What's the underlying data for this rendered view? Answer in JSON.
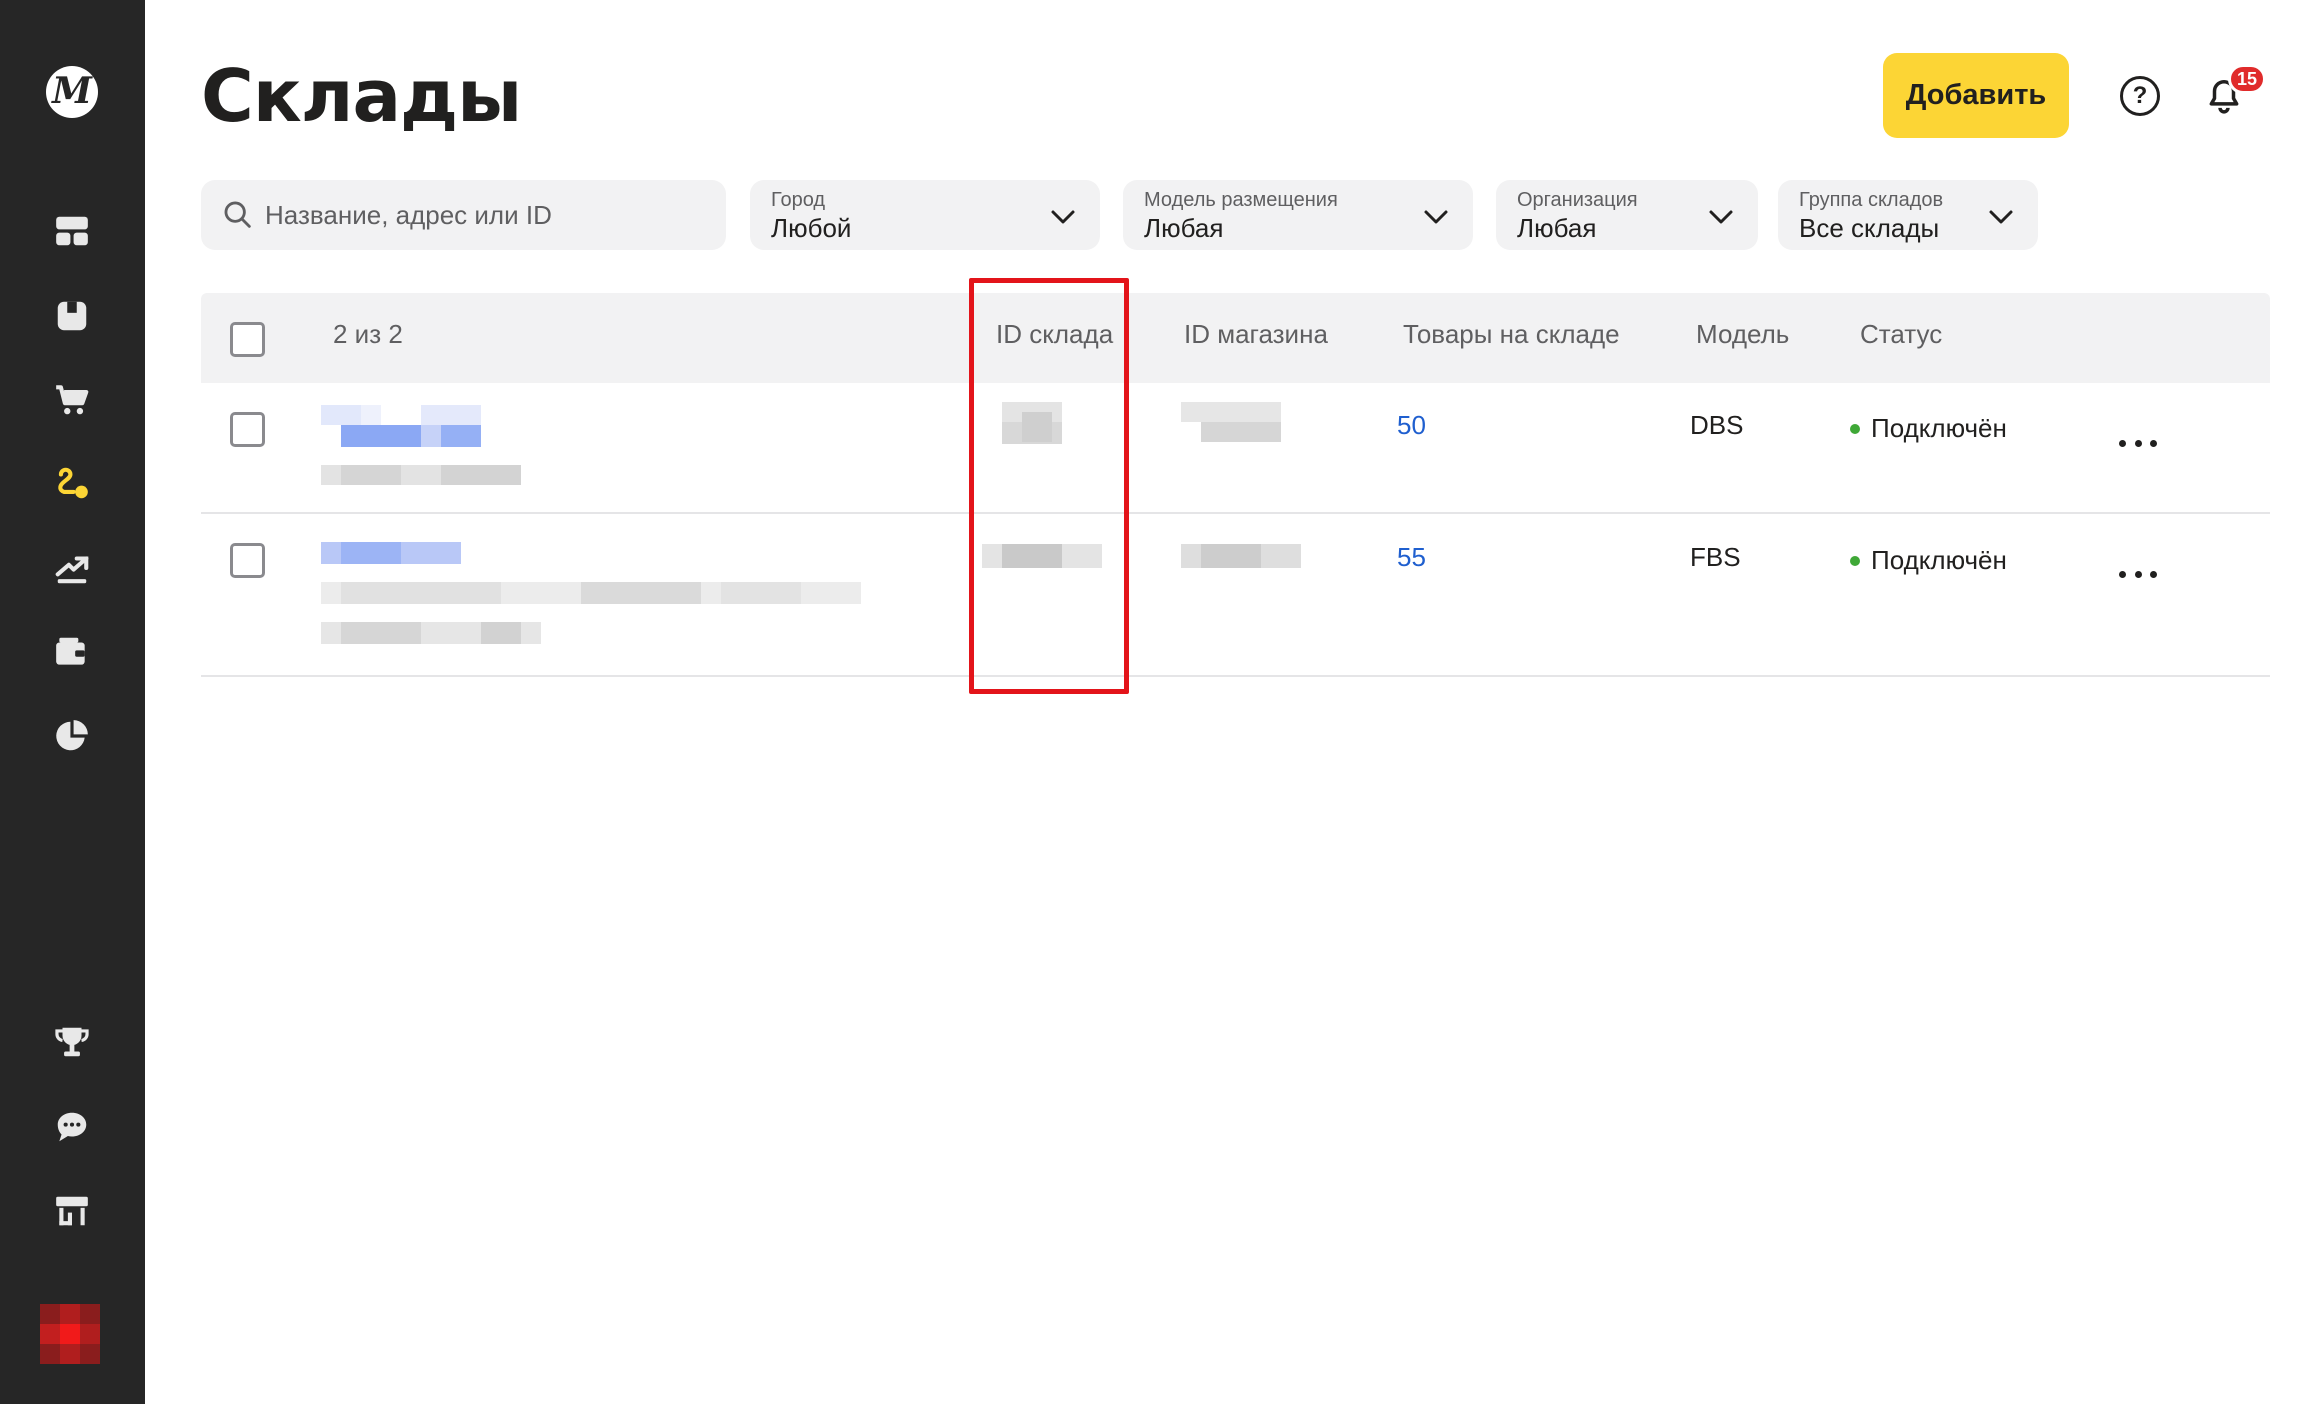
{
  "sidebar": {
    "logo_letter": "М",
    "items": [
      {
        "icon": "dashboard-icon"
      },
      {
        "icon": "products-icon"
      },
      {
        "icon": "cart-icon"
      },
      {
        "icon": "logistics-icon",
        "active": true
      },
      {
        "icon": "growth-icon"
      },
      {
        "icon": "wallet-icon"
      },
      {
        "icon": "pie-chart-icon"
      }
    ],
    "bottom_items": [
      {
        "icon": "trophy-icon"
      },
      {
        "icon": "chat-icon"
      },
      {
        "icon": "store-icon"
      }
    ],
    "colors": {
      "background": "#262626",
      "icon": "#e8e8e8",
      "active": "#fcd535"
    }
  },
  "header": {
    "title": "Склады",
    "add_label": "Добавить",
    "help_symbol": "?",
    "notifications_count": "15"
  },
  "filters": {
    "search_placeholder": "Название, адрес или ID",
    "city": {
      "label": "Город",
      "value": "Любой"
    },
    "placement_model": {
      "label": "Модель размещения",
      "value": "Любая"
    },
    "organization": {
      "label": "Организация",
      "value": "Любая"
    },
    "warehouse_group": {
      "label": "Группа складов",
      "value": "Все склады"
    }
  },
  "table": {
    "count_label": "2 из 2",
    "columns": {
      "warehouse_id": "ID склада",
      "shop_id": "ID магазина",
      "goods": "Товары на складе",
      "model": "Модель",
      "status": "Статус"
    },
    "rows": [
      {
        "goods": "50",
        "model": "DBS",
        "status": "Подключён"
      },
      {
        "goods": "55",
        "model": "FBS",
        "status": "Подключён"
      }
    ]
  },
  "colors": {
    "accent_yellow": "#fcd535",
    "link_blue": "#1f5fcf",
    "status_green": "#3fa837",
    "highlight_red": "#e3141a",
    "badge_red": "#e02b2b"
  }
}
